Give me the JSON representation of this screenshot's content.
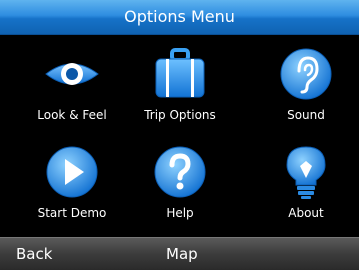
{
  "header": {
    "title": "Options Menu"
  },
  "menu": {
    "items": [
      {
        "label": "Look & Feel",
        "icon": "eye-icon"
      },
      {
        "label": "Trip Options",
        "icon": "suitcase-icon"
      },
      {
        "label": "Sound",
        "icon": "ear-icon"
      },
      {
        "label": "Start Demo",
        "icon": "play-icon"
      },
      {
        "label": "Help",
        "icon": "question-icon"
      },
      {
        "label": "About",
        "icon": "lightbulb-icon"
      }
    ]
  },
  "softkeys": {
    "left": "Back",
    "center": "Map"
  },
  "colors": {
    "accent": "#1f86e6",
    "title_bar": "#2e8de0",
    "icon_blue": "#1f8be8"
  }
}
